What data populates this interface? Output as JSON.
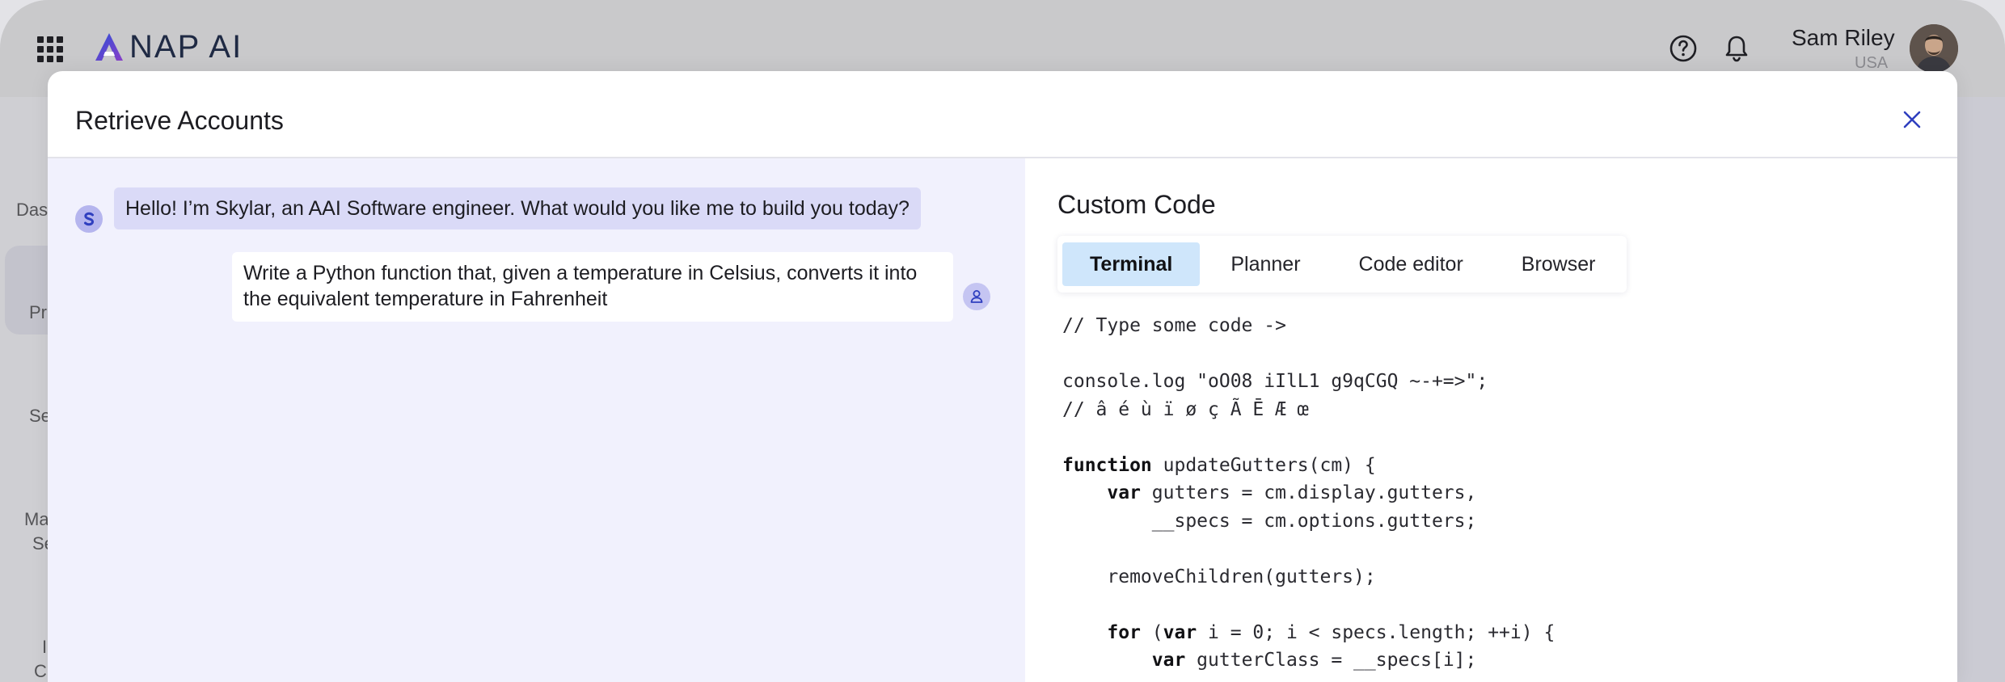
{
  "app": {
    "logo_text": "NAP AI",
    "user_name": "Sam Riley",
    "user_location": "USA",
    "accent_color": "#2f3fbf",
    "icons": [
      "apps-grid-icon",
      "help-icon",
      "bell-icon",
      "close-icon",
      "bot-icon",
      "user-icon"
    ]
  },
  "sidebar": {
    "items": [
      {
        "label": "Das"
      },
      {
        "label": "Pr"
      },
      {
        "label": "Se"
      },
      {
        "label": "Ma"
      },
      {
        "label": "Se"
      },
      {
        "label": "I"
      },
      {
        "label": "C"
      }
    ]
  },
  "modal": {
    "title": "Retrieve Accounts"
  },
  "chat": {
    "messages": [
      {
        "role": "assistant",
        "text": "Hello! I’m Skylar, an AAI Software engineer. What would you like me to build you today?"
      },
      {
        "role": "user",
        "text": "Write a Python function that, given a temperature in Celsius, converts it into the equivalent temperature in Fahrenheit"
      }
    ]
  },
  "code_panel": {
    "title": "Custom Code",
    "tabs": [
      {
        "label": "Terminal",
        "active": true
      },
      {
        "label": "Planner",
        "active": false
      },
      {
        "label": "Code editor",
        "active": false
      },
      {
        "label": "Browser",
        "active": false
      }
    ],
    "code_lines": [
      [
        {
          "t": "// Type some code ->"
        }
      ],
      [
        {
          "t": ""
        }
      ],
      [
        {
          "t": "console.log \"oO08 iIlL1 g9qCGQ ~-+=>\";"
        }
      ],
      [
        {
          "t": "// â é ù ï ø ç Ã Ē Æ œ"
        }
      ],
      [
        {
          "t": ""
        }
      ],
      [
        {
          "t": "function",
          "kw": true
        },
        {
          "t": " updateGutters(cm) {"
        }
      ],
      [
        {
          "t": "    "
        },
        {
          "t": "var",
          "kw": true
        },
        {
          "t": " gutters = cm.display.gutters,"
        }
      ],
      [
        {
          "t": "        __specs = cm.options.gutters;"
        }
      ],
      [
        {
          "t": ""
        }
      ],
      [
        {
          "t": "    removeChildren(gutters);"
        }
      ],
      [
        {
          "t": ""
        }
      ],
      [
        {
          "t": "    "
        },
        {
          "t": "for",
          "kw": true
        },
        {
          "t": " ("
        },
        {
          "t": "var",
          "kw": true
        },
        {
          "t": " i = 0; i < specs.length; ++i) {"
        }
      ],
      [
        {
          "t": "        "
        },
        {
          "t": "var",
          "kw": true
        },
        {
          "t": " gutterClass = __specs[i];"
        }
      ]
    ]
  }
}
